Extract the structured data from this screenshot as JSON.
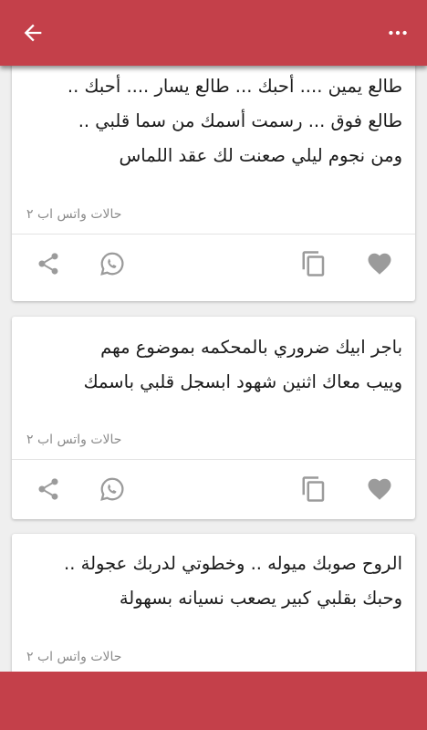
{
  "theme": {
    "primary": "#c4404a",
    "background": "#efefef",
    "icon_color": "#9b9b9b"
  },
  "header": {
    "back_icon": "arrow-left",
    "menu_icon": "more-horizontal"
  },
  "cards": [
    {
      "text": "طالع يمين .... أحبك ... طالع يسار .... أحبك ..\nطالع فوق ... رسمت أسمك من سما قلبي ..\nومن نجوم ليلي صعنت لك عقد اللماس",
      "category": "حالات واتس اب ٢"
    },
    {
      "text": "باجر ابيك ضروري بالمحكمه بموضوع مهم\nوييب معاك اثنين شهود ابسجل قلبي باسمك",
      "category": "حالات واتس اب ٢"
    },
    {
      "text": "الروح صوبك ميوله .. وخطوتي لدربك عجولة ..\nوحبك بقلبي كبير يصعب نسيانه بسهولة",
      "category": "حالات واتس اب ٢"
    }
  ],
  "actions": [
    "share",
    "whatsapp",
    "copy",
    "favorite"
  ]
}
